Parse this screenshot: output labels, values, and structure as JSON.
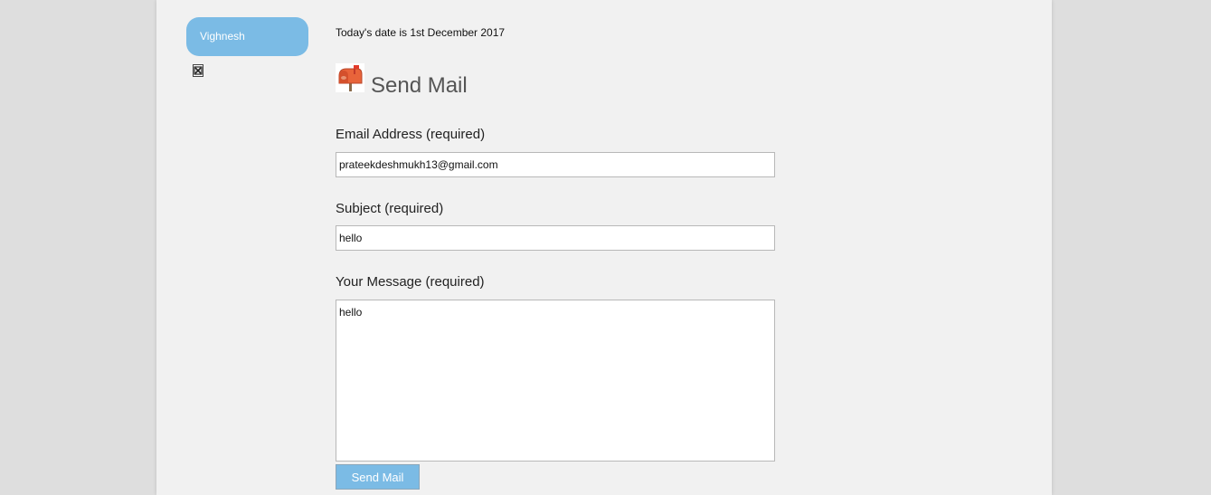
{
  "sidebar": {
    "user_name": "Vighnesh"
  },
  "header": {
    "date_text": "Today's date is 1st December 2017",
    "title": "Send Mail"
  },
  "form": {
    "email_label": "Email Address (required)",
    "email_value": "prateekdeshmukh13@gmail.com",
    "subject_label": "Subject (required)",
    "subject_value": "hello",
    "message_label": "Your Message (required)",
    "message_value": "hello",
    "submit_label": "Send Mail"
  },
  "colors": {
    "accent": "#7bbbe5",
    "page_background": "#f1f1f1",
    "outer_background": "#dedede"
  },
  "icons": {
    "heading_icon": "mailbox-icon",
    "broken_image": "broken-image-icon"
  }
}
